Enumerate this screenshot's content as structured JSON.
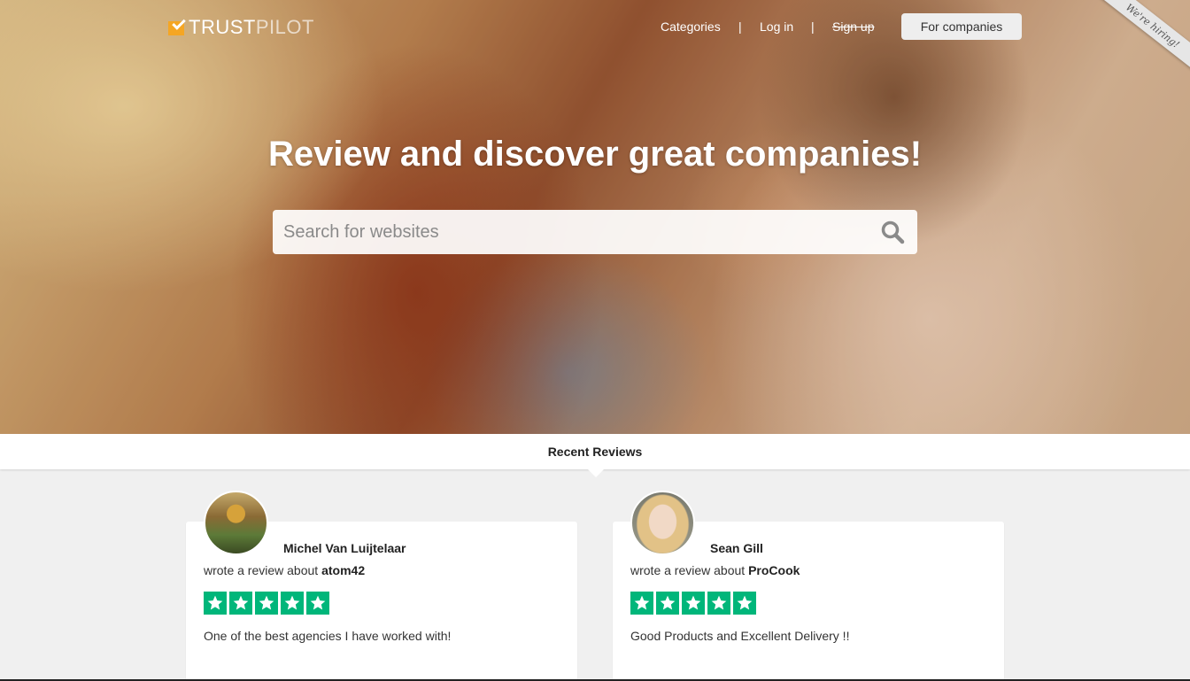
{
  "brand": {
    "logo_main": "TRUST",
    "logo_light": "PILOT"
  },
  "nav": {
    "categories": "Categories",
    "separator": "|",
    "login": "Log in",
    "signup": "Sign up",
    "for_companies": "For companies"
  },
  "ribbon": "We're hiring!",
  "hero": {
    "headline": "Review and discover great companies!",
    "search_placeholder": "Search for websites"
  },
  "recent": {
    "title": "Recent Reviews",
    "reviews": [
      {
        "name": "Michel Van Luijtelaar",
        "wrote_prefix": "wrote a review about",
        "company": "atom42",
        "stars": 5,
        "text": "One of the best agencies I have worked with!"
      },
      {
        "name": "Sean Gill",
        "wrote_prefix": "wrote a review about",
        "company": "ProCook",
        "stars": 5,
        "text": "Good Products and Excellent Delivery !!"
      }
    ]
  },
  "colors": {
    "star_green": "#00b67a",
    "logo_orange": "#f5a623"
  },
  "icons": {
    "search": "search-icon",
    "star": "star-icon"
  }
}
